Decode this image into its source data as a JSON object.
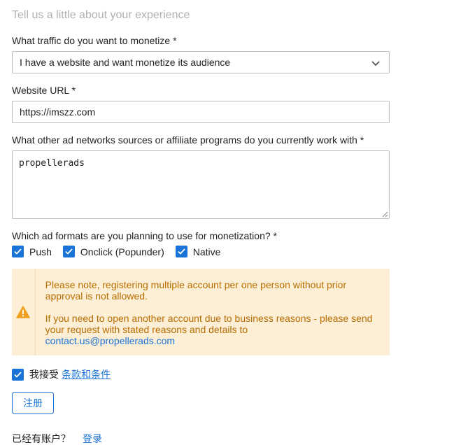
{
  "heading": "Tell us a little about your experience",
  "traffic": {
    "label": "What traffic do you want to monetize *",
    "selected": "I have a website and want monetize its audience"
  },
  "website": {
    "label": "Website URL *",
    "value": "https://imszz.com"
  },
  "networks": {
    "label": "What other ad networks sources or affiliate programs do you currently work with *",
    "value": "propellerads"
  },
  "formats": {
    "label": "Which ad formats are you planning to use for monetization? *",
    "options": [
      {
        "label": "Push",
        "checked": true
      },
      {
        "label": "Onclick (Popunder)",
        "checked": true
      },
      {
        "label": "Native",
        "checked": true
      }
    ]
  },
  "notice": {
    "line1": "Please note, registering multiple account per one person without prior approval is not allowed.",
    "line2": "If you need to open another account due to business reasons - please send your request with stated reasons and details to",
    "email": "contact.us@propellerads.com",
    "color": "#b86e00",
    "background": "#fdeed6"
  },
  "terms": {
    "prefix": "我接受",
    "link": "条款和条件",
    "checked": true
  },
  "register_label": "注册",
  "footer": {
    "question": "已经有账户？",
    "login": "登录"
  },
  "colors": {
    "accent": "#1a73d6",
    "warning_icon": "#f0a020"
  }
}
